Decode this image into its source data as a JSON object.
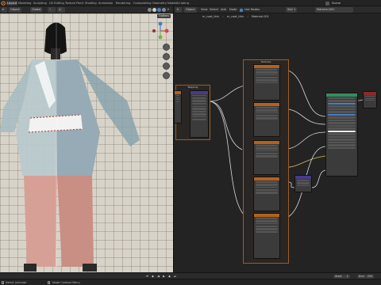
{
  "workspace_tabs": [
    {
      "label": "Layout",
      "active": true
    },
    {
      "label": "Modeling",
      "active": false
    },
    {
      "label": "Sculpting",
      "active": false
    },
    {
      "label": "UV Editing",
      "active": false
    },
    {
      "label": "Texture Paint",
      "active": false
    },
    {
      "label": "Shading",
      "active": false
    },
    {
      "label": "Animation",
      "active": false
    },
    {
      "label": "Rendering",
      "active": false
    },
    {
      "label": "Compositing",
      "active": false
    },
    {
      "label": "Geometry Nodes",
      "active": false
    },
    {
      "label": "Scripting",
      "active": false
    }
  ],
  "scene_label": "Scene",
  "viewport_header": {
    "mode": "Object",
    "orientation": "Global",
    "options": "Options"
  },
  "node_header": {
    "editor_type": "Object",
    "view": "View",
    "select": "Select",
    "add": "Add",
    "node": "Node",
    "use_nodes": "Use Nodes",
    "slot": "Slot 1",
    "material_field": "Material.001"
  },
  "breadcrumb": {
    "object": "m_coat_thin",
    "mesh": "m_coat_thin",
    "material": "Material.001"
  },
  "frames": {
    "mapping": "Mapping",
    "textures": "Textures"
  },
  "timeline": {
    "start_label": "Start",
    "start_value": "1",
    "end_label": "End",
    "end_value": "250"
  },
  "status": {
    "left": "Select   Activate",
    "middle": "Node Context Menu"
  },
  "colors": {
    "accent": "#4a7dc4",
    "frame_border": "#9a5e2a",
    "texture_header": "#b4601f",
    "shader_header": "#2f8f5f",
    "vector_header": "#4a3a8a",
    "link": "#d9d9d9",
    "link_yellow": "#d4c35a"
  },
  "icons": [
    "blender-logo-icon",
    "object-mode-icon",
    "gizmo-axes-icon",
    "zoom-icon",
    "hand-icon",
    "camera-icon",
    "grid-icon",
    "play-icon",
    "reverse-play-icon",
    "jump-start-icon",
    "jump-end-icon",
    "keyframe-icon",
    "mouse-icon"
  ]
}
